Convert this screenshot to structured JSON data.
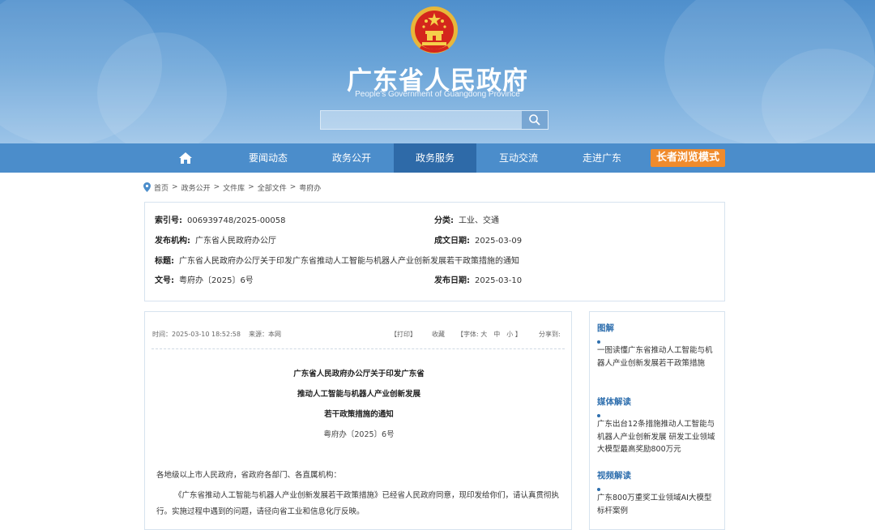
{
  "header": {
    "title": "广东省人民政府",
    "subtitle": "People's Government of Guangdong Province",
    "search_placeholder": ""
  },
  "nav": {
    "items": [
      "要闻动态",
      "政务公开",
      "政务服务",
      "互动交流",
      "走进广东"
    ],
    "active_index": 2,
    "elder_mode": "长者浏览模式"
  },
  "breadcrumb": [
    "首页",
    "政务公开",
    "文件库",
    "全部文件",
    "粤府办"
  ],
  "meta": {
    "index_label": "索引号:",
    "index_value": "006939748/2025-00058",
    "category_label": "分类:",
    "category_value": "工业、交通",
    "publisher_label": "发布机构:",
    "publisher_value": "广东省人民政府办公厅",
    "created_label": "成文日期:",
    "created_value": "2025-03-09",
    "title_label": "标题:",
    "title_value": "广东省人民政府办公厅关于印发广东省推动人工智能与机器人产业创新发展若干政策措施的通知",
    "docno_label": "文号:",
    "docno_value": "粤府办〔2025〕6号",
    "published_label": "发布日期:",
    "published_value": "2025-03-10"
  },
  "article": {
    "time": "时间：2025-03-10 18:52:58",
    "source": "来源：本网",
    "print": "【打印】",
    "favorite": "收藏",
    "font_size": "【字体: 大　中　小 】",
    "share": "分享到:",
    "title_lines": [
      "广东省人民政府办公厅关于印发广东省",
      "推动人工智能与机器人产业创新发展",
      "若干政策措施的通知"
    ],
    "doc_no": "粤府办〔2025〕6号",
    "salutation": "各地级以上市人民政府，省政府各部门、各直属机构：",
    "body_line1": "《广东省推动人工智能与机器人产业创新发展若干政策措施》已经省人民政府同意，现印发给你们，请认真贯彻执",
    "body_line2": "行。实施过程中遇到的问题，请径向省工业和信息化厅反映。"
  },
  "sidebar": {
    "sections": [
      {
        "heading": "图解",
        "link": "一图读懂广东省推动人工智能与机器人产业创新发展若干政策措施"
      },
      {
        "heading": "媒体解读",
        "link": "广东出台12条措施推动人工智能与机器人产业创新发展 研发工业领域大模型最高奖励800万元"
      },
      {
        "heading": "视频解读",
        "link": "广东800万重奖工业领域AI大模型标杆案例"
      }
    ]
  },
  "colors": {
    "header_blue": "#4f8fcc",
    "nav_blue": "#4b8dcb",
    "nav_active": "#2e6aa8",
    "elder_orange": "#f08b2c",
    "link_blue": "#2f6fae"
  }
}
